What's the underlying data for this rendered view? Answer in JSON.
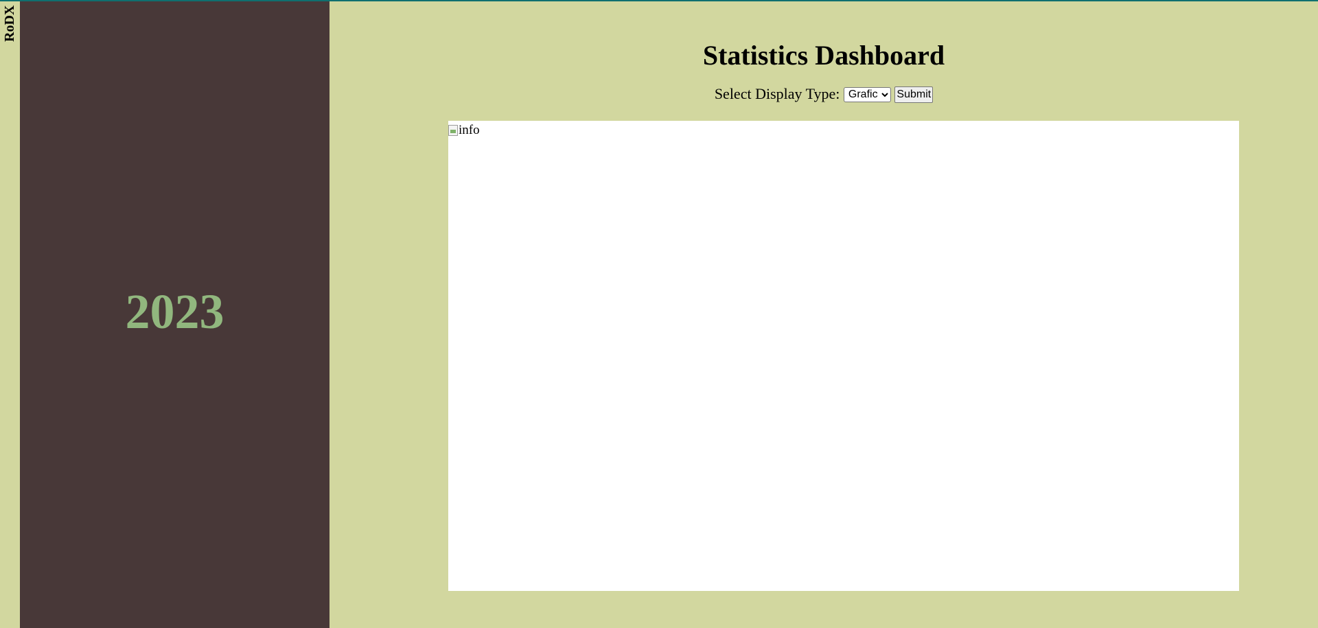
{
  "brand": {
    "text": "RoDX"
  },
  "sidebar": {
    "year": "2023"
  },
  "main": {
    "title": "Statistics Dashboard",
    "display_type_label": "Select Display Type:",
    "display_select": {
      "selected": "Grafic",
      "options": [
        "Grafic"
      ]
    },
    "submit_label": "Submit",
    "image_alt": "info"
  },
  "colors": {
    "background": "#d2d79f",
    "sidebar": "#483838",
    "year_text": "#91b77e",
    "panel": "#ffffff",
    "top_line": "#0f6f6f"
  }
}
